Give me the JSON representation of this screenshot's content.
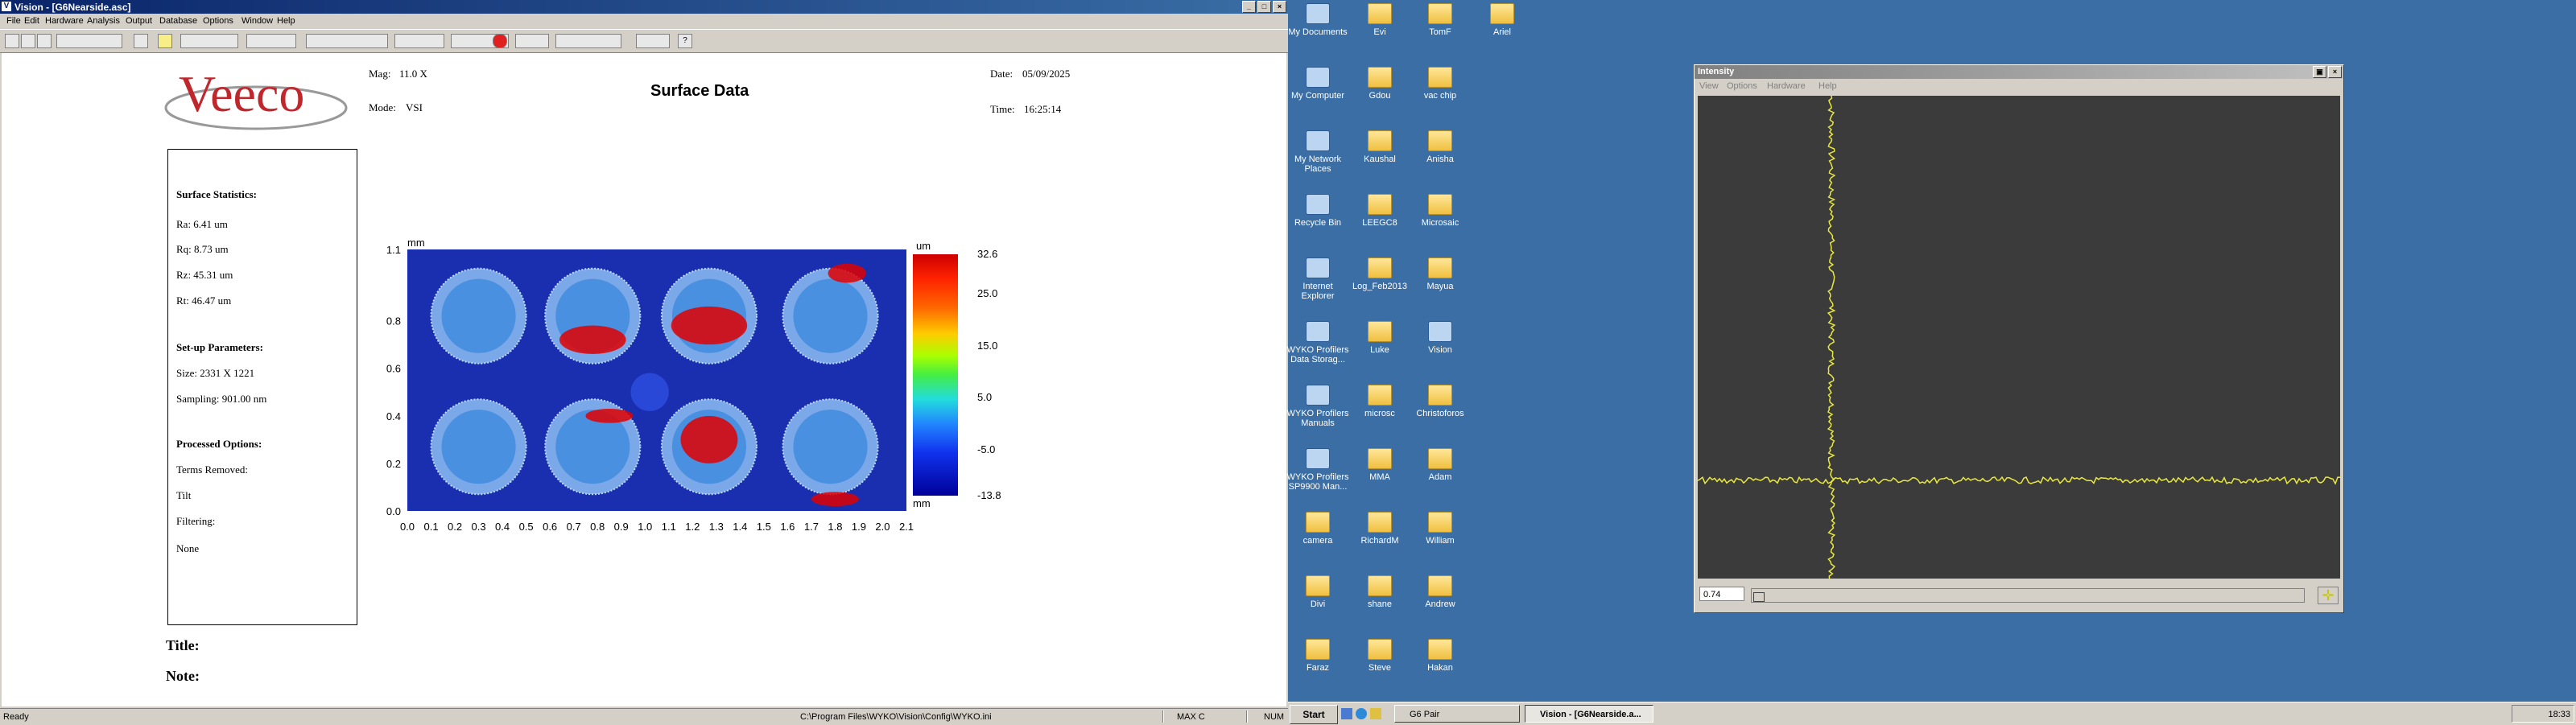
{
  "vision": {
    "title": "Vision - [G6Nearside.asc]",
    "menu": [
      "File",
      "Edit",
      "Hardware",
      "Analysis",
      "Output",
      "Database",
      "Options",
      "Window",
      "Help"
    ],
    "report": {
      "mag_label": "Mag:",
      "mag_value": "11.0 X",
      "mode_label": "Mode:",
      "mode_value": "VSI",
      "heading": "Surface Data",
      "date_label": "Date:",
      "date_value": "05/09/2025",
      "time_label": "Time:",
      "time_value": "16:25:14",
      "logo_text": "Veeco",
      "stats": {
        "surface_heading": "Surface Statistics:",
        "ra": "Ra:  6.41 um",
        "rq": "Rq:  8.73 um",
        "rz": "Rz:  45.31 um",
        "rt": "Rt:  46.47 um",
        "setup_heading": "Set-up Parameters:",
        "size": "Size: 2331 X 1221",
        "sampling": "Sampling:  901.00 nm",
        "processed_heading": "Processed Options:",
        "terms_removed": "Terms Removed:",
        "tilt": "Tilt",
        "filtering": "Filtering:",
        "none": "None"
      },
      "title_label": "Title:",
      "note_label": "Note:"
    },
    "statusbar": {
      "ready": "Ready",
      "path": "C:\\Program Files\\WYKO\\Vision\\Config\\WYKO.ini",
      "max_c": "MAX C",
      "num": "NUM"
    }
  },
  "chart_data": {
    "type": "heatmap",
    "title": "",
    "x_unit": "mm",
    "y_unit": "mm",
    "colorbar_unit": "um",
    "x_ticks": [
      "0.0",
      "0.1",
      "0.2",
      "0.3",
      "0.4",
      "0.5",
      "0.6",
      "0.7",
      "0.8",
      "0.9",
      "1.0",
      "1.1",
      "1.2",
      "1.3",
      "1.4",
      "1.5",
      "1.6",
      "1.7",
      "1.8",
      "1.9",
      "2.0",
      "2.1"
    ],
    "y_ticks": [
      "0.0",
      "0.2",
      "0.4",
      "0.6",
      "0.8",
      "1.1"
    ],
    "colorbar_ticks": [
      "32.6",
      "25.0",
      "15.0",
      "5.0",
      "-5.0",
      "-13.8"
    ],
    "xlim": [
      0,
      2.1
    ],
    "ylim": [
      0,
      1.1
    ],
    "zlim": [
      -13.8,
      32.6
    ],
    "features": [
      {
        "kind": "well",
        "cx": 0.3,
        "cy": 0.82,
        "r": 0.2
      },
      {
        "kind": "well",
        "cx": 0.78,
        "cy": 0.82,
        "r": 0.2
      },
      {
        "kind": "well",
        "cx": 1.27,
        "cy": 0.82,
        "r": 0.2
      },
      {
        "kind": "well",
        "cx": 1.78,
        "cy": 0.82,
        "r": 0.2
      },
      {
        "kind": "well",
        "cx": 0.3,
        "cy": 0.27,
        "r": 0.2
      },
      {
        "kind": "well",
        "cx": 0.78,
        "cy": 0.27,
        "r": 0.2
      },
      {
        "kind": "well",
        "cx": 1.27,
        "cy": 0.27,
        "r": 0.2
      },
      {
        "kind": "well",
        "cx": 1.78,
        "cy": 0.27,
        "r": 0.2
      },
      {
        "kind": "pad",
        "cx": 1.02,
        "cy": 0.5,
        "r": 0.08
      }
    ],
    "colors": {
      "background": "#1a2fb0",
      "well": "#4a90e0",
      "high": "#e00000"
    }
  },
  "desktop": {
    "icons": [
      {
        "label": "My Documents",
        "kind": "sys"
      },
      {
        "label": "My Computer",
        "kind": "sys"
      },
      {
        "label": "My Network Places",
        "kind": "sys"
      },
      {
        "label": "Recycle Bin",
        "kind": "sys"
      },
      {
        "label": "Internet Explorer",
        "kind": "sys"
      },
      {
        "label": "WYKO Profilers Data Storag...",
        "kind": "sys"
      },
      {
        "label": "WYKO Profilers Manuals",
        "kind": "sys"
      },
      {
        "label": "WYKO Profilers SP9900 Man...",
        "kind": "sys"
      },
      {
        "label": "camera",
        "kind": "folder"
      },
      {
        "label": "Divi",
        "kind": "folder"
      },
      {
        "label": "Faraz",
        "kind": "folder"
      },
      {
        "label": "Evi",
        "kind": "folder"
      },
      {
        "label": "Gdou",
        "kind": "folder"
      },
      {
        "label": "Kaushal",
        "kind": "folder"
      },
      {
        "label": "LEEGC8",
        "kind": "folder"
      },
      {
        "label": "Log_Feb2013",
        "kind": "folder"
      },
      {
        "label": "Luke",
        "kind": "folder"
      },
      {
        "label": "microsc",
        "kind": "folder"
      },
      {
        "label": "MMA",
        "kind": "folder"
      },
      {
        "label": "RichardM",
        "kind": "folder"
      },
      {
        "label": "shane",
        "kind": "folder"
      },
      {
        "label": "Steve",
        "kind": "folder"
      },
      {
        "label": "TomF",
        "kind": "folder"
      },
      {
        "label": "vac chip",
        "kind": "folder"
      },
      {
        "label": "Anisha",
        "kind": "folder"
      },
      {
        "label": "Microsaic",
        "kind": "folder"
      },
      {
        "label": "Mayua",
        "kind": "folder"
      },
      {
        "label": "Vision",
        "kind": "sys"
      },
      {
        "label": "Christoforos",
        "kind": "folder"
      },
      {
        "label": "Adam",
        "kind": "folder"
      },
      {
        "label": "William",
        "kind": "folder"
      },
      {
        "label": "Andrew",
        "kind": "folder"
      },
      {
        "label": "Hakan",
        "kind": "folder"
      },
      {
        "label": "Ariel",
        "kind": "folder"
      }
    ]
  },
  "intensity": {
    "title": "Intensity",
    "menu": [
      "View",
      "Options",
      "Hardware",
      "Help"
    ],
    "value": "0.74"
  },
  "taskbar": {
    "start": "Start",
    "tasks": [
      "G6 Pair",
      "Vision - [G6Nearside.a..."
    ],
    "clock": "18:33"
  }
}
